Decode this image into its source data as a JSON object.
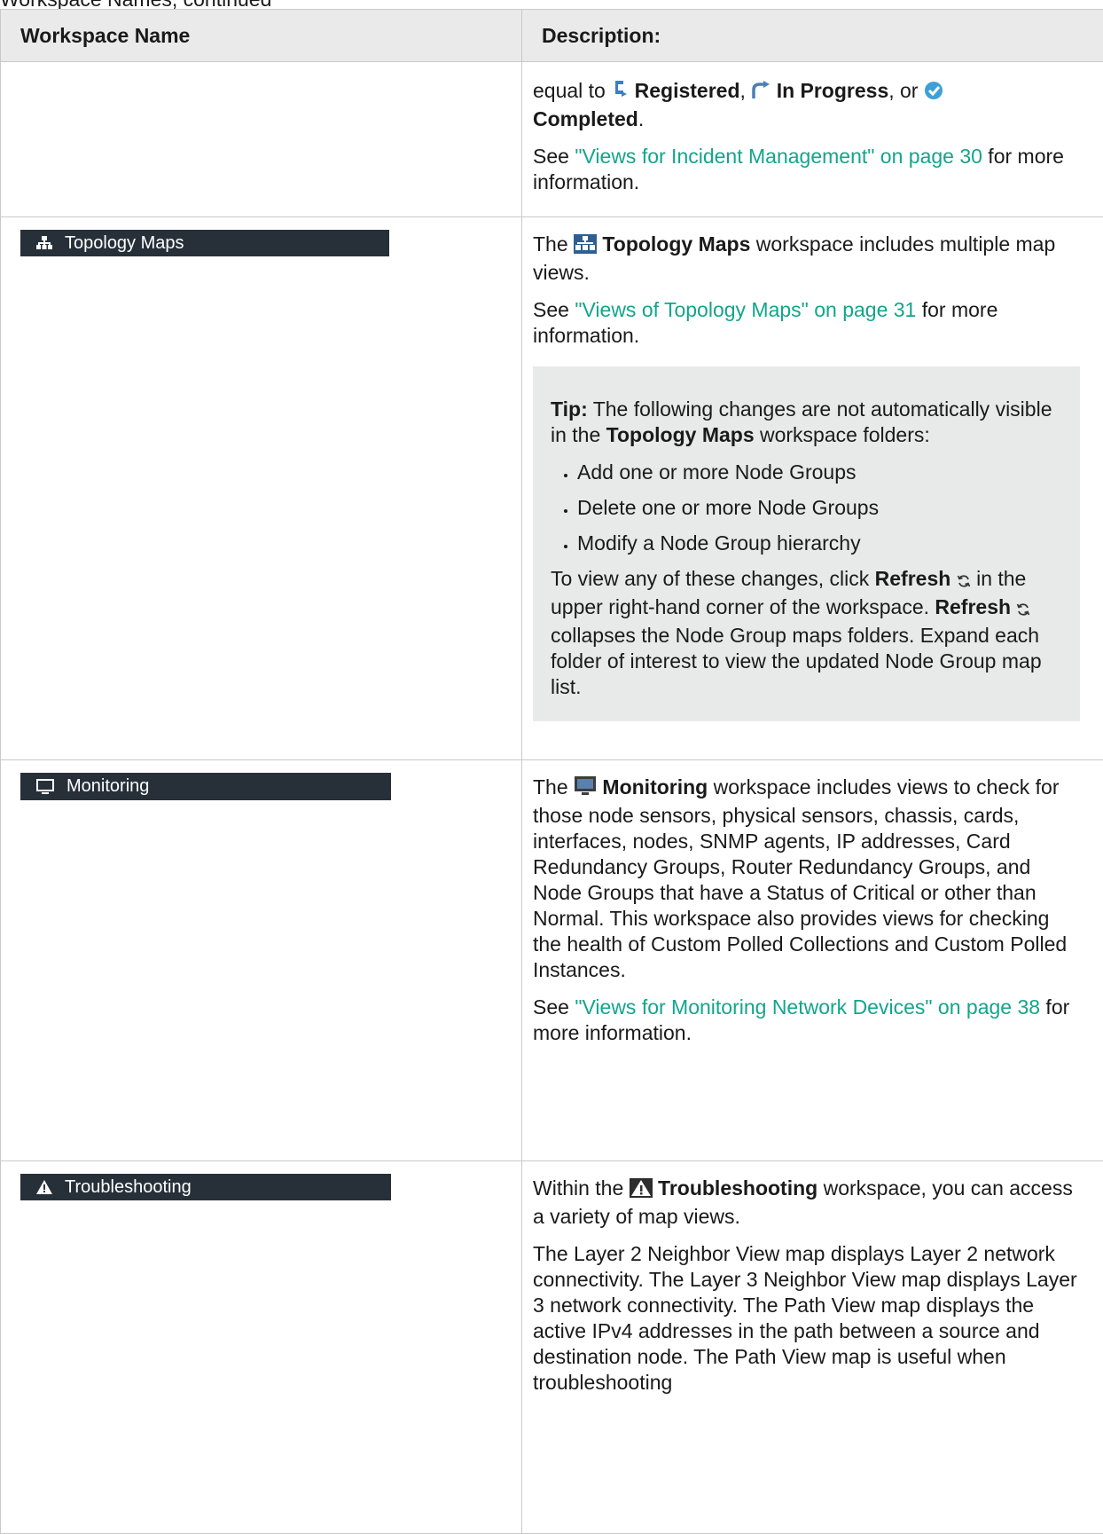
{
  "top_fragment": "Workspace Names, continued",
  "table": {
    "headers": [
      "Workspace Name",
      "Description:"
    ]
  },
  "rows": {
    "incident": {
      "equal_to": "equal to",
      "registered": "Registered",
      "in_progress": "In Progress",
      "or": ", or",
      "completed": "Completed",
      "period": ".",
      "see": "See ",
      "link": "\"Views for Incident Management\" on page 30",
      "more": " for more information."
    },
    "topology": {
      "button_label": "Topology Maps",
      "the": "The",
      "name": "Topology Maps",
      "desc": " workspace includes multiple map views.",
      "see": "See ",
      "link": "\"Views of Topology Maps\" on page 31",
      "more": " for more information.",
      "tip": {
        "label": "Tip:",
        "intro_a": " The following changes are not automatically visible in the ",
        "intro_b": "Topology Maps",
        "intro_c": " workspace folders:",
        "items": [
          "Add one or more Node Groups",
          "Delete one or more Node Groups",
          "Modify a Node Group hierarchy"
        ],
        "p2_a": "To view any of these changes, click ",
        "refresh": "Refresh",
        "p2_b": " in the upper right-hand corner of the workspace. ",
        "p2_c": " collapses the Node Group maps folders. Expand each folder of interest to view the updated Node Group map list."
      }
    },
    "monitoring": {
      "button_label": "Monitoring",
      "the": "The",
      "name": "Monitoring",
      "desc": " workspace includes views to check for those node sensors, physical sensors, chassis, cards, interfaces, nodes, SNMP agents, IP addresses, Card Redundancy Groups, Router Redundancy Groups, and Node Groups that have a Status of Critical or other than Normal. This workspace also provides views for checking the health of Custom Polled Collections and Custom Polled Instances.",
      "see": "See ",
      "link": "\"Views for Monitoring Network Devices\" on page 38",
      "more": " for more information."
    },
    "troubleshooting": {
      "button_label": "Troubleshooting",
      "within": "Within the",
      "name": "Troubleshooting",
      "desc": " workspace, you can access a variety of map views.",
      "p2": "The Layer 2 Neighbor View map displays Layer 2 network connectivity. The Layer 3 Neighbor View map displays Layer 3 network connectivity. The Path View map displays the active IPv4 addresses in the path between a source and destination node. The Path View map is useful when troubleshooting"
    }
  },
  "colors": {
    "link": "#13a58b",
    "button_bg": "#273039",
    "header_bg": "#eaeaea",
    "tip_bg": "#e8eaea"
  }
}
